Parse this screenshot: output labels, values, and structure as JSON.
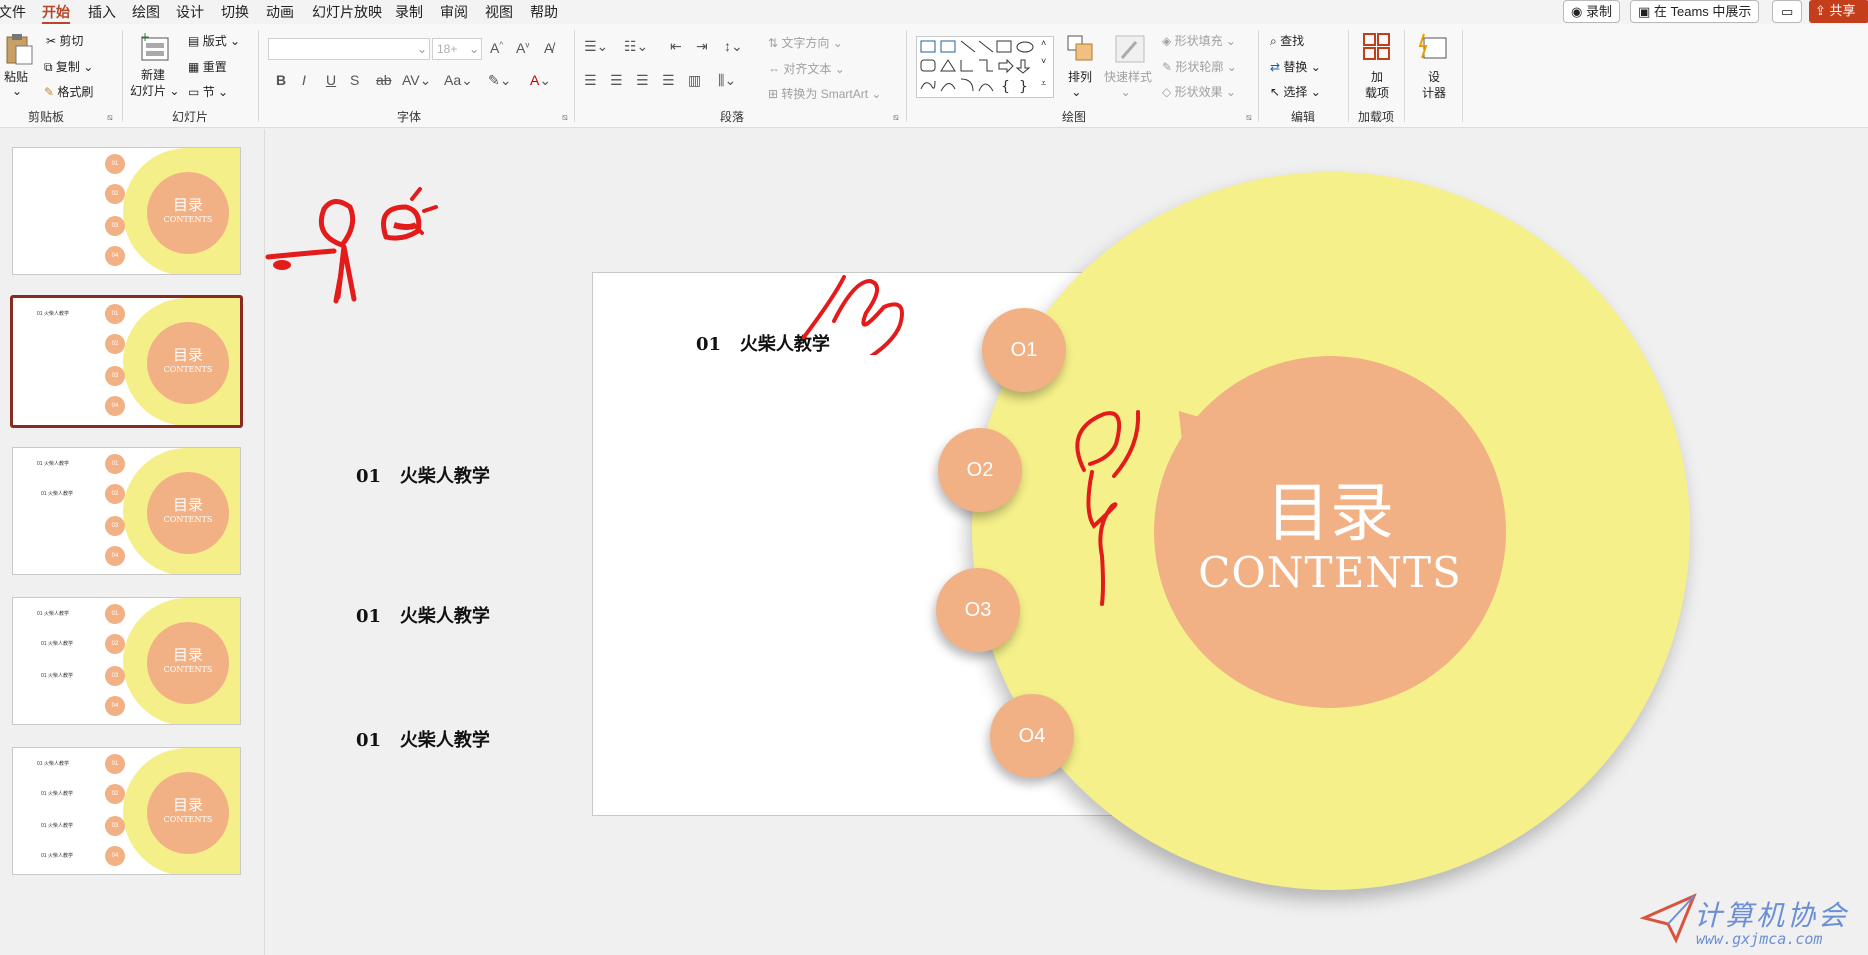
{
  "menubar": {
    "items": [
      "文件",
      "开始",
      "插入",
      "绘图",
      "设计",
      "切换",
      "动画",
      "幻灯片放映",
      "录制",
      "审阅",
      "视图",
      "帮助"
    ],
    "active": "开始",
    "record_label": "录制",
    "teams_label": "在 Teams 中展示",
    "share_label": "共享"
  },
  "ribbon": {
    "clipboard": {
      "paste": "粘贴",
      "cut": "剪切",
      "copy": "复制",
      "format_painter": "格式刷",
      "group": "剪贴板"
    },
    "slides": {
      "new_slide_line1": "新建",
      "new_slide_line2": "幻灯片",
      "layout": "版式",
      "reset": "重置",
      "section": "节",
      "group": "幻灯片"
    },
    "font": {
      "font_size": "18+",
      "group": "字体"
    },
    "paragraph": {
      "text_direction": "文字方向",
      "align_text": "对齐文本",
      "smartart": "转换为 SmartArt",
      "group": "段落"
    },
    "drawing": {
      "arrange": "排列",
      "quick_styles": "快速样式",
      "shape_fill": "形状填充",
      "shape_outline": "形状轮廓",
      "shape_effects": "形状效果",
      "group": "绘图"
    },
    "editing": {
      "find": "查找",
      "replace": "替换",
      "select": "选择",
      "group": "编辑"
    },
    "addins": {
      "label_line1": "加",
      "label_line2": "载项",
      "group": "加载项"
    },
    "designer": {
      "label_line1": "设",
      "label_line2": "计器"
    }
  },
  "thumbnails": [
    {
      "title": "目录",
      "sub": "CONTENTS",
      "lines": []
    },
    {
      "title": "目录",
      "sub": "CONTENTS",
      "lines": [
        "01    火柴人教学"
      ]
    },
    {
      "title": "目录",
      "sub": "CONTENTS",
      "lines": [
        "01    火柴人教学",
        "01    火柴人教学"
      ]
    },
    {
      "title": "目录",
      "sub": "CONTENTS",
      "lines": [
        "01    火柴人教学",
        "01    火柴人教学",
        "01    火柴人教学"
      ]
    },
    {
      "title": "目录",
      "sub": "CONTENTS",
      "lines": [
        "01    火柴人教学",
        "01    火柴人教学",
        "01    火柴人教学",
        "01    火柴人教学"
      ]
    }
  ],
  "thumb_dots": [
    "01",
    "02",
    "03",
    "04"
  ],
  "slide": {
    "items": [
      {
        "num": "01",
        "text": "火柴人教学"
      },
      {
        "num": "01",
        "text": "火柴人教学"
      },
      {
        "num": "01",
        "text": "火柴人教学"
      },
      {
        "num": "01",
        "text": "火柴人教学"
      }
    ],
    "title": "目录",
    "subtitle": "CONTENTS",
    "circles": [
      "O1",
      "O2",
      "O3",
      "O4"
    ]
  },
  "colors": {
    "accent": "#b7472a",
    "yellow": "#f5f08a",
    "orange": "#f2b085",
    "ink": "#e31b1b"
  },
  "watermark": {
    "name": "计算机协会",
    "url": "www.gxjmca.com"
  }
}
